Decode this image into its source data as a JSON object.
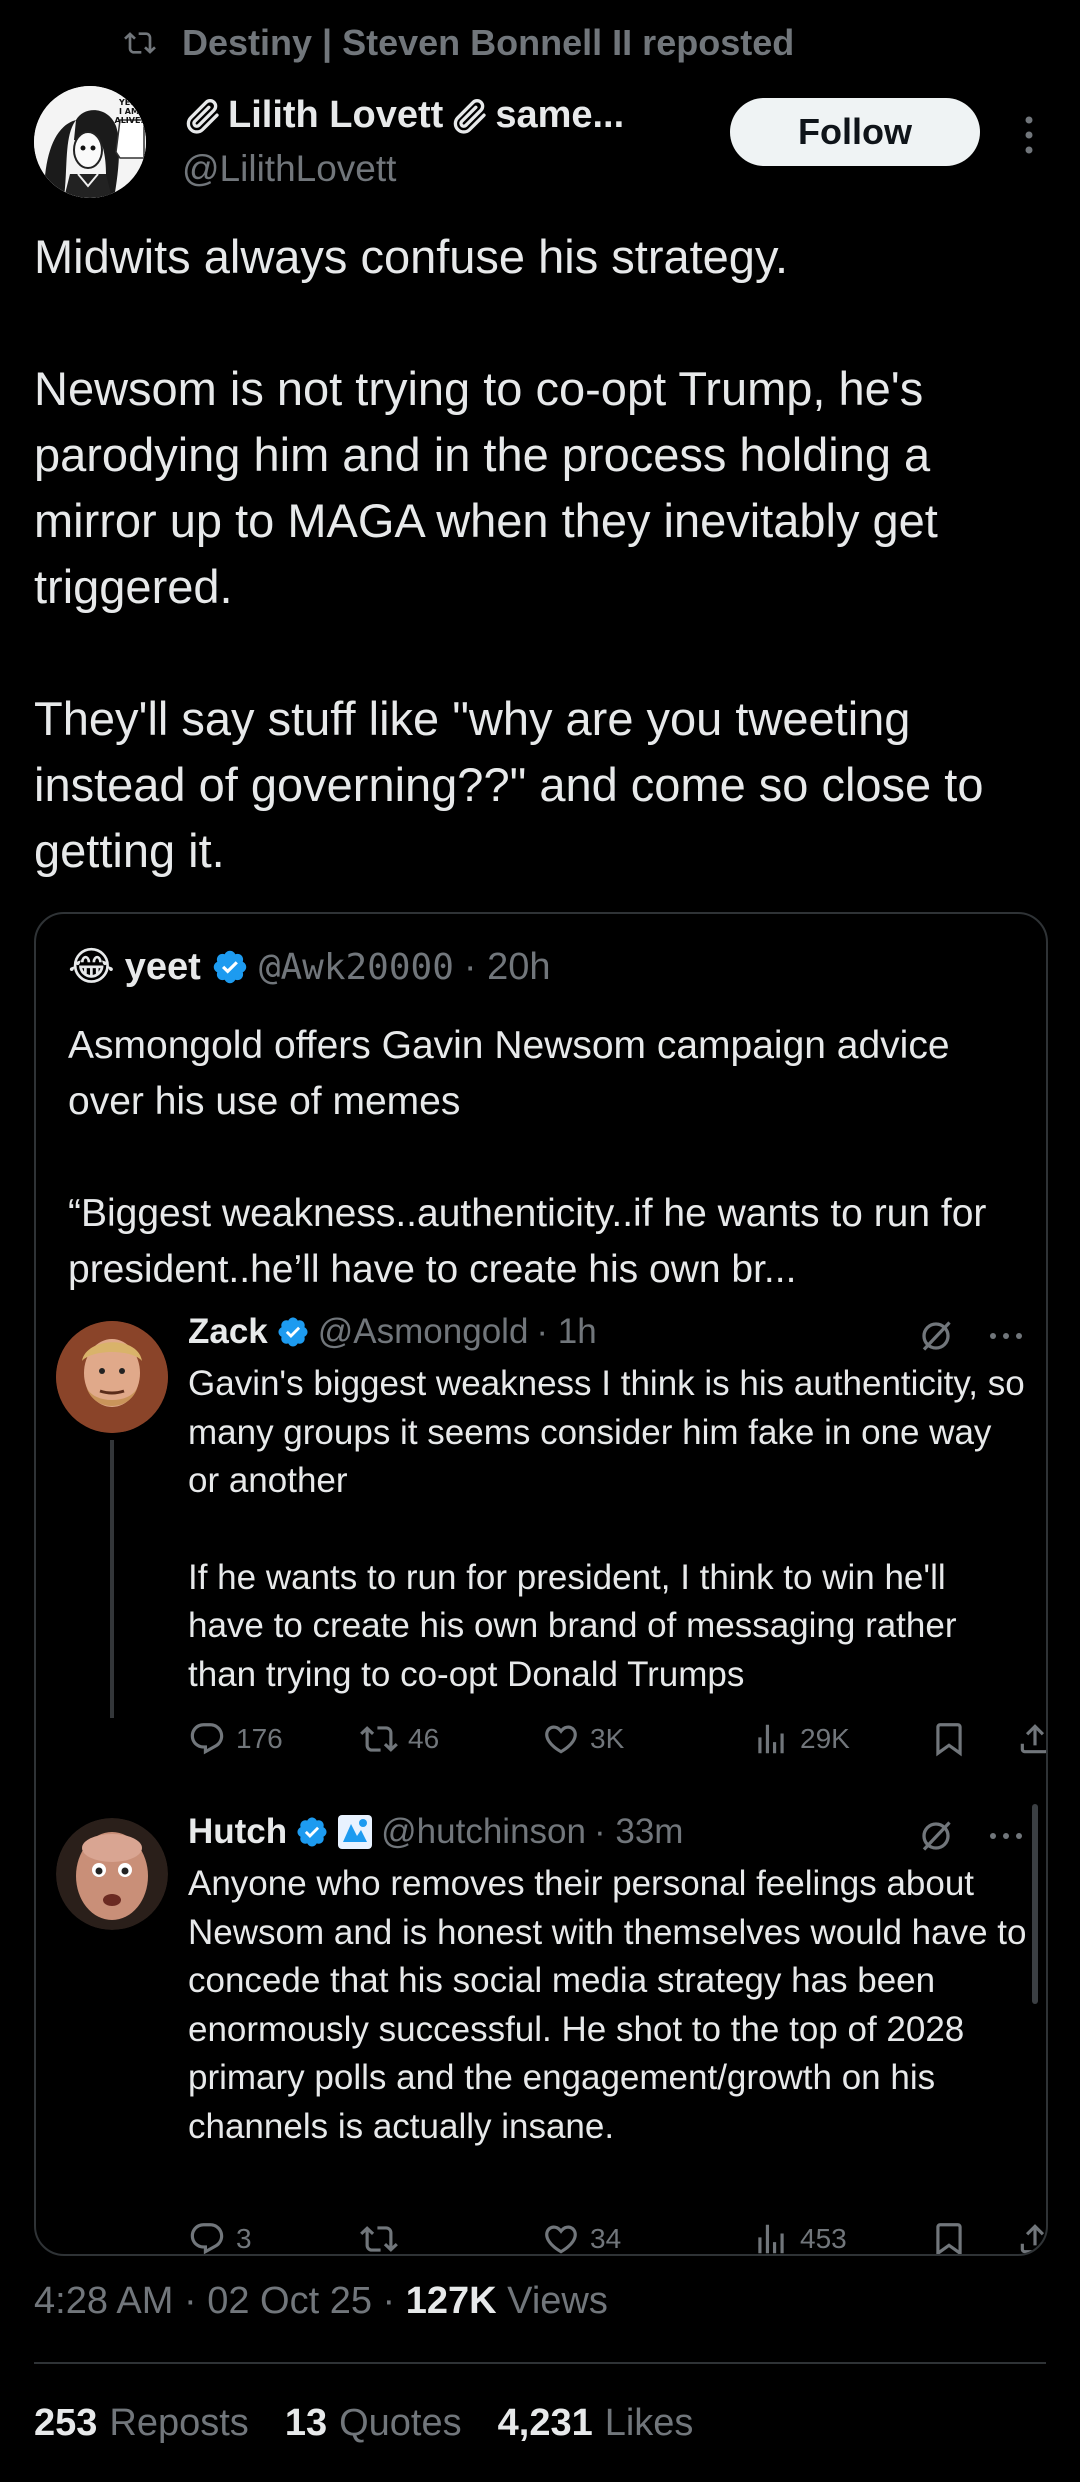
{
  "repost": {
    "text": "Destiny | Steven Bonnell II reposted",
    "icon": "repost-icon"
  },
  "author": {
    "name": "Lilith Lovett",
    "name_suffix": "same...",
    "handle": "@LilithLovett",
    "avatar_caption": [
      "YES,",
      "I AM",
      "ALIVE."
    ],
    "follow_label": "Follow"
  },
  "tweet": {
    "paragraphs": [
      "Midwits always confuse his strategy.",
      "Newsom is not trying to co-opt Trump, he's parodying him and in the process holding a mirror up to MAGA when they inevitably get triggered.",
      "They'll say stuff like \"why are you tweeting instead of governing??\" and come so close to getting it."
    ]
  },
  "quote": {
    "name": "yeet",
    "emoji": "😂",
    "handle": "@Awk20000",
    "time": "· 20h",
    "paragraphs": [
      "Asmongold offers Gavin Newsom campaign advice over his use of memes",
      "“Biggest weakness..authenticity..if he wants to run for president..he’ll have to create his own br..."
    ],
    "replies": [
      {
        "name": "Zack",
        "handle": "@Asmongold",
        "time": "· 1h",
        "paragraphs": [
          "Gavin's biggest weakness I think is his authenticity, so many groups it seems consider him fake in one way or another",
          "If he wants to run for president, I think to win he'll have to create his own brand of messaging rather than trying to co-opt Donald Trumps"
        ],
        "replies": "176",
        "reposts": "46",
        "likes": "3K",
        "views": "29K"
      },
      {
        "name": "Hutch",
        "handle": "@hutchinson",
        "time": "· 33m",
        "paragraphs": [
          "Anyone who removes their personal feelings about Newsom and is honest with themselves would have to concede that his social media strategy has been enormously successful. He shot to the top of 2028 primary polls and the engagement/growth on his channels is actually insane."
        ],
        "replies": "3",
        "reposts": "",
        "likes": "34",
        "views": "453"
      }
    ]
  },
  "meta": {
    "time": "4:28 AM",
    "date": "02 Oct 25",
    "views_count": "127K",
    "views_label": "Views"
  },
  "stats": {
    "reposts": "253",
    "reposts_label": "Reposts",
    "quotes": "13",
    "quotes_label": "Quotes",
    "likes": "4,231",
    "likes_label": "Likes"
  },
  "colors": {
    "background": "#000000",
    "text": "#e7e9ea",
    "muted": "#71767b",
    "verified": "#1d9bf0",
    "border": "#2f3336"
  }
}
